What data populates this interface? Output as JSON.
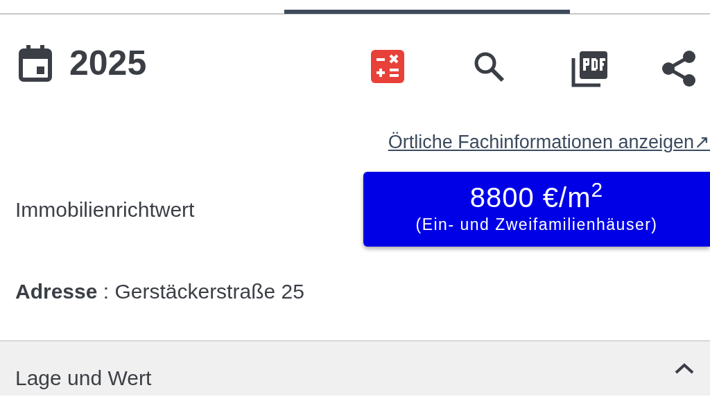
{
  "header": {
    "year": "2025"
  },
  "link": {
    "label": "Örtliche Fachinformationen anzeigen↗"
  },
  "value": {
    "label": "Immobilienrichtwert",
    "price": "8800 €/m$^{2}$",
    "category": "(Ein- und Zweifamilienhäuser)"
  },
  "address": {
    "label": "Adresse",
    "separator": ":",
    "text": "Gerstäckerstraße 25"
  },
  "section": {
    "title": "Lage und Wert",
    "expanded": true
  }
}
